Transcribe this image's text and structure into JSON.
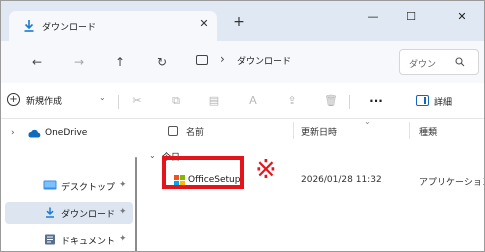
{
  "window": {
    "tab_title": "ダウンロード",
    "tab_close": "✕",
    "new_tab": "+",
    "minimize": "—",
    "maximize": "☐",
    "close": "✕"
  },
  "nav": {
    "back": "←",
    "forward": "→",
    "up": "↑",
    "refresh": "↻",
    "address_separator": "›",
    "address": "ダウンロード",
    "search_placeholder": "ダウン"
  },
  "toolbar": {
    "new_label": "新規作成",
    "new_caret": "⌄",
    "cut": "✂",
    "copy": "⧉",
    "paste": "▤",
    "rename": "Ａ",
    "share": "⇪",
    "delete": "🗑",
    "more": "···",
    "details_label": "詳細"
  },
  "sidebar": {
    "items": [
      {
        "label": "OneDrive",
        "chevron": "›",
        "icon": "onedrive-cloud-icon"
      },
      {
        "label": "デスクトップ",
        "pin": "✦",
        "icon": "desktop-icon"
      },
      {
        "label": "ダウンロード",
        "pin": "✦",
        "icon": "download-arrow-icon"
      },
      {
        "label": "ドキュメント",
        "pin": "✦",
        "icon": "document-icon"
      }
    ]
  },
  "file_list": {
    "columns": {
      "name": "名前",
      "date": "更新日時",
      "type": "種類"
    },
    "sort_indicator": "⌄",
    "group_caret": "⌄",
    "group_label": "今日",
    "rows": [
      {
        "name": "OfficeSetup",
        "date": "2026/01/28 11:32",
        "type": "アプリケーション"
      }
    ]
  },
  "annotation": {
    "mark": "※",
    "color": "#e5141b"
  },
  "colors": {
    "accent": "#1664c0",
    "titlebar": "#dfe8f3",
    "selected": "#dce5f0"
  }
}
